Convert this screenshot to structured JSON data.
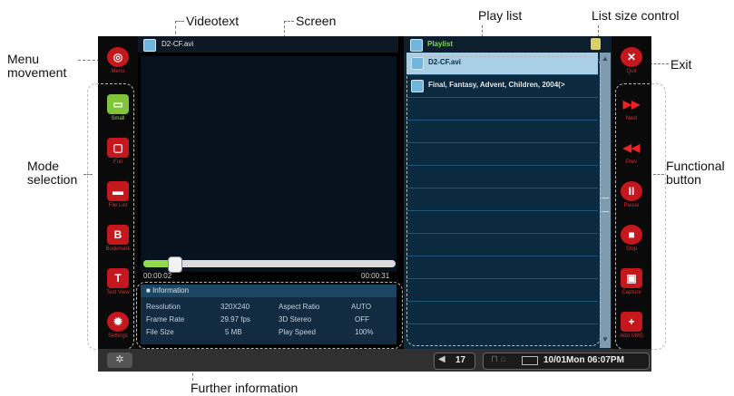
{
  "callouts": {
    "videotext": "Videotext",
    "screen": "Screen",
    "play_list": "Play list",
    "list_size_control": "List size control",
    "menu_movement": "Menu\nmovement",
    "exit": "Exit",
    "mode_selection": "Mode\nselection",
    "functional_button": "Functional\nbutton",
    "further_information": "Further information"
  },
  "left_sidebar": [
    {
      "label": "Menu",
      "icon": "menu-icon"
    },
    {
      "label": "Small",
      "icon": "small-screen-icon"
    },
    {
      "label": "Full",
      "icon": "full-screen-icon"
    },
    {
      "label": "File List",
      "icon": "folder-icon"
    },
    {
      "label": "Bookmark",
      "icon": "bookmark-icon"
    },
    {
      "label": "Text View",
      "icon": "text-view-icon"
    },
    {
      "label": "Settings",
      "icon": "gear-icon"
    }
  ],
  "right_sidebar": [
    {
      "label": "Quit",
      "icon": "close-icon"
    },
    {
      "label": "Next",
      "icon": "next-icon"
    },
    {
      "label": "Prev",
      "icon": "prev-icon"
    },
    {
      "label": "Pause",
      "icon": "pause-icon"
    },
    {
      "label": "Stop",
      "icon": "stop-icon"
    },
    {
      "label": "Capture",
      "icon": "capture-icon"
    },
    {
      "label": "Add UMS",
      "icon": "add-icon"
    }
  ],
  "player": {
    "filename": "D2-CF.avi",
    "elapsed": "00:00:02",
    "total": "00:00:31",
    "progress_fraction": 0.06
  },
  "information": {
    "title": "Information",
    "rows": [
      {
        "k1": "Resolution",
        "v1": "320X240",
        "k2": "Aspect Ratio",
        "v2": "AUTO"
      },
      {
        "k1": "Frame Rate",
        "v1": "29.97 fps",
        "k2": "3D Stereo",
        "v2": "OFF"
      },
      {
        "k1": "File Size",
        "v1": "5 MB",
        "k2": "Play Speed",
        "v2": "100%"
      }
    ]
  },
  "playlist": {
    "title": "Playlist",
    "items": [
      "D2-CF.avi",
      "Final, Fantasy, Advent, Children, 2004(>"
    ]
  },
  "statusbar": {
    "volume": "17",
    "datetime": "10/01Mon 06:07PM"
  },
  "colors": {
    "accent_red": "#c4181e",
    "active_green": "#7fc43b",
    "selected_row": "#a9cfe6",
    "playlist_title": "#7ed957"
  }
}
